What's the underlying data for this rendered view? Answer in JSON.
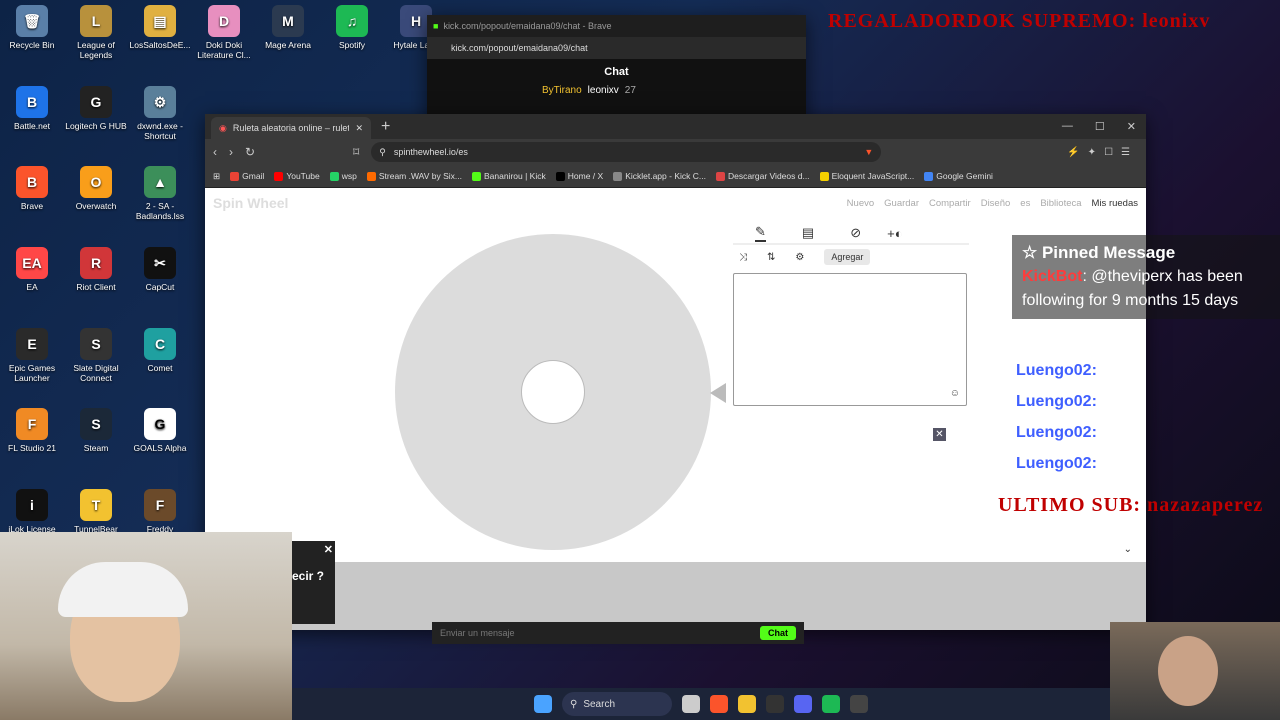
{
  "desktop": {
    "icons": [
      {
        "label": "Recycle Bin",
        "color": "#5a7fa8",
        "glyph": "🗑"
      },
      {
        "label": "League of Legends",
        "color": "#b8913c",
        "glyph": "L"
      },
      {
        "label": "LosSaltosDeE...",
        "color": "#e0b040",
        "glyph": "▤"
      },
      {
        "label": "Doki Doki Literature Cl...",
        "color": "#e78fbf",
        "glyph": "D"
      },
      {
        "label": "Mage Arena",
        "color": "#2b3a50",
        "glyph": "M"
      },
      {
        "label": "Spotify",
        "color": "#1db954",
        "glyph": "♫"
      },
      {
        "label": "Hytale Laun",
        "color": "#3a4a7a",
        "glyph": "H"
      },
      {
        "label": "Battle.net",
        "color": "#1e73e8",
        "glyph": "B"
      },
      {
        "label": "Logitech G HUB",
        "color": "#222",
        "glyph": "G"
      },
      {
        "label": "dxwnd.exe - Shortcut",
        "color": "#5a7f9a",
        "glyph": "⚙"
      },
      {
        "label": "Brave",
        "color": "#fb542b",
        "glyph": "B"
      },
      {
        "label": "Overwatch",
        "color": "#f99e1a",
        "glyph": "O"
      },
      {
        "label": "2 - SA - Badlands.lss",
        "color": "#3c8f5a",
        "glyph": "▲"
      },
      {
        "label": "EA",
        "color": "#ff4747",
        "glyph": "EA"
      },
      {
        "label": "Riot Client",
        "color": "#d13639",
        "glyph": "R"
      },
      {
        "label": "CapCut",
        "color": "#111",
        "glyph": "✂"
      },
      {
        "label": "Epic Games Launcher",
        "color": "#2a2a2a",
        "glyph": "E"
      },
      {
        "label": "Slate Digital Connect",
        "color": "#333",
        "glyph": "S"
      },
      {
        "label": "Comet",
        "color": "#1fa0a0",
        "glyph": "C"
      },
      {
        "label": "FL Studio 21",
        "color": "#f08a24",
        "glyph": "F"
      },
      {
        "label": "Steam",
        "color": "#1b2838",
        "glyph": "S"
      },
      {
        "label": "GOALS Alpha",
        "color": "#fff",
        "glyph": "G"
      },
      {
        "label": "iLok License",
        "color": "#111",
        "glyph": "i"
      },
      {
        "label": "TunnelBear",
        "color": "#f2c230",
        "glyph": "T"
      },
      {
        "label": "Freddy Fazbear's",
        "color": "#6b4a2a",
        "glyph": "F"
      }
    ]
  },
  "kick_window": {
    "title": "kick.com/popout/emaidana09/chat - Brave",
    "address": "kick.com/popout/emaidana09/chat",
    "header": "Chat",
    "user": "ByTirano",
    "user2": "leonixv",
    "count": "27"
  },
  "browser": {
    "tab_title": "Ruleta aleatoria online – ruleta d",
    "url": "spinthewheel.io/es",
    "bookmarks": [
      "Gmail",
      "YouTube",
      "wsp",
      "Stream .WAV by Six...",
      "Bananirou | Kick",
      "Home / X",
      "Kicklet.app - Kick C...",
      "Descargar Videos d...",
      "Eloquent JavaScript...",
      "Google Gemini"
    ],
    "bookmark_colors": [
      "#ea4335",
      "#ff0000",
      "#25d366",
      "#ff6a00",
      "#53fc18",
      "#000",
      "#888",
      "#d44",
      "#f5d000",
      "#4285f4"
    ]
  },
  "site": {
    "logo": "Spin Wheel",
    "nav": [
      "Nuevo",
      "Guardar",
      "Compartir",
      "Diseño",
      "es"
    ],
    "library": "Biblioteca",
    "my_wheels": "Mis ruedas",
    "add_label": "Agregar"
  },
  "overlay": {
    "pinned_title": "Pinned Message",
    "pinned_user": "KickBot",
    "pinned_text": "@theviperx has been following for 9 months 15 days",
    "chat_user": "Luengo02:"
  },
  "stream": {
    "top_banner": "REGALADORDOK SUPREMO: leonixv",
    "bottom_banner": "ULTIMO SUB: nazazaperez",
    "ad_text": "ecir ?"
  },
  "taskbar": {
    "search": "Search"
  },
  "chat_input": {
    "placeholder": "Enviar un mensaje",
    "button": "Chat"
  }
}
